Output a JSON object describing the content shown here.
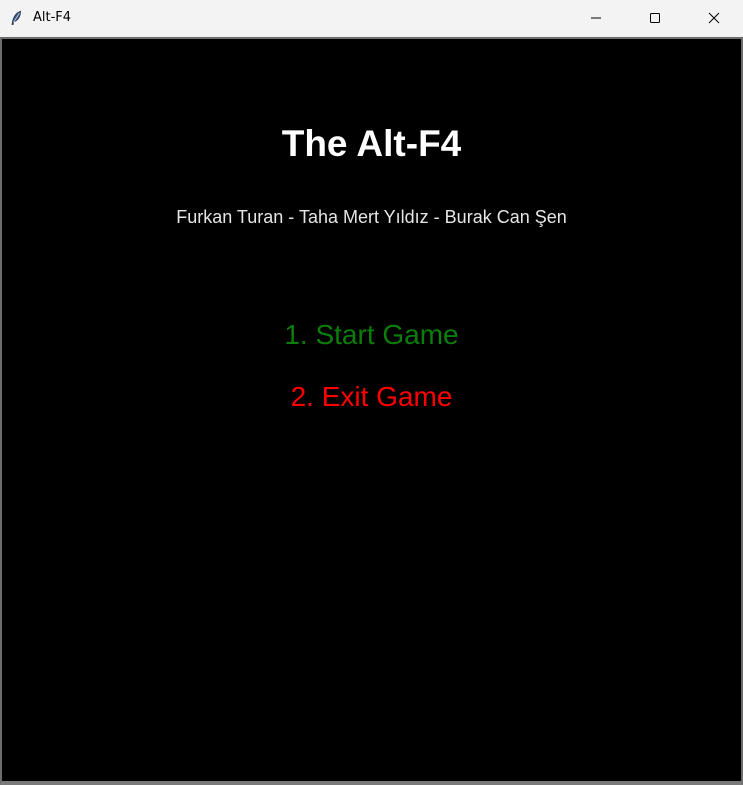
{
  "window": {
    "title": "Alt-F4",
    "icon": "feather-icon",
    "controls": {
      "minimize": "minimize-icon",
      "maximize": "maximize-icon",
      "close": "close-icon"
    }
  },
  "game": {
    "title": "The Alt-F4",
    "credits": "Furkan Turan - Taha Mert Yıldız - Burak Can Şen",
    "menu": [
      {
        "label": "1. Start Game",
        "color": "#0a7d0a"
      },
      {
        "label": "2. Exit Game",
        "color": "#ff0000"
      }
    ],
    "background": "#000000"
  }
}
